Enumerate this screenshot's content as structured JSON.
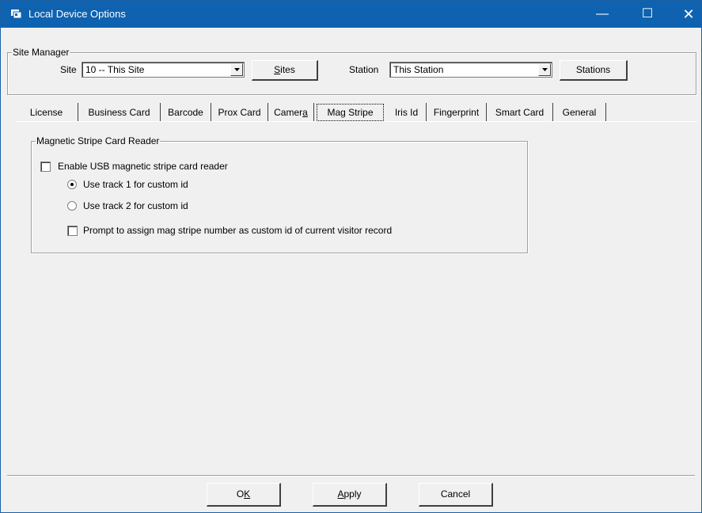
{
  "window": {
    "title": "Local Device Options",
    "title_bar_color": "#0e62b0",
    "controls": {
      "minimize": "—",
      "maximize": "☐",
      "close": "✕"
    }
  },
  "site_manager": {
    "group_label": "Site Manager",
    "site_label": "Site",
    "site_value": "10 -- This Site",
    "sites_button_prefix": "",
    "sites_button_mnemonic": "S",
    "sites_button_rest": "ites",
    "station_label": "Station",
    "station_value": "This Station",
    "stations_button": "Stations"
  },
  "tabs": [
    {
      "label": "License"
    },
    {
      "label": "Business Card"
    },
    {
      "label": "Barcode"
    },
    {
      "label": "Prox Card"
    },
    {
      "label_prefix": "Camer",
      "label_mnemonic": "a"
    },
    {
      "label": "Mag Stripe",
      "active": true
    },
    {
      "label": "Iris Id"
    },
    {
      "label": "Fingerprint"
    },
    {
      "label": "Smart Card"
    },
    {
      "label": "General"
    }
  ],
  "mag_stripe": {
    "group_label": "Magnetic Stripe Card Reader",
    "enable_label": "Enable USB magnetic stripe card reader",
    "enable_checked": false,
    "track1_label": "Use track 1 for custom id",
    "track1_selected": true,
    "track2_label": "Use track 2 for custom id",
    "track2_selected": false,
    "prompt_label": "Prompt to assign mag stripe number as custom id of current visitor record",
    "prompt_checked": false
  },
  "footer": {
    "ok_prefix": "O",
    "ok_mnemonic": "K",
    "apply_mnemonic": "A",
    "apply_rest": "pply",
    "cancel": "Cancel"
  }
}
